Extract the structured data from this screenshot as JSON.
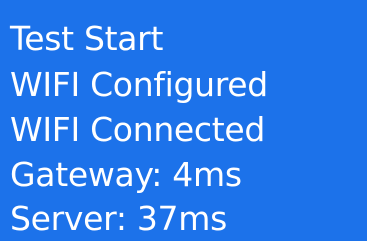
{
  "display": {
    "background_color": "#1c72ea",
    "text_color": "#ffffff",
    "lines": [
      "Test Start",
      "WIFI Configured",
      "WIFI Connected",
      "Gateway: 4ms",
      "Server: 37ms"
    ]
  }
}
